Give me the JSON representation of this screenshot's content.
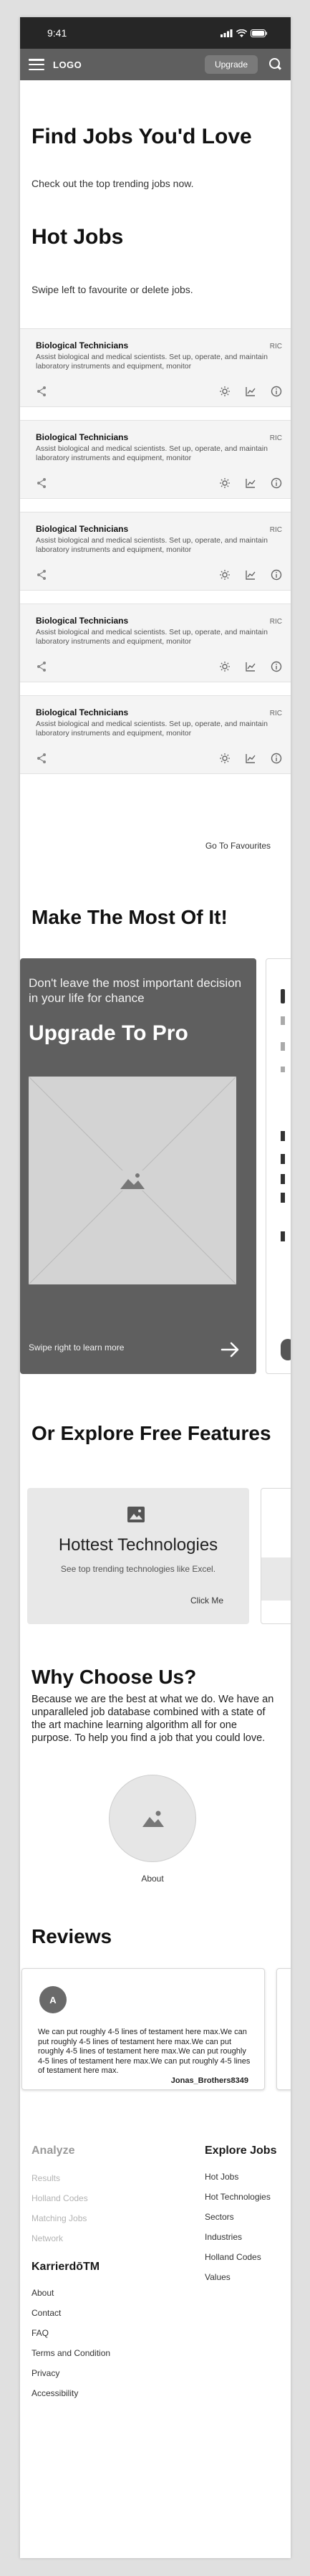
{
  "statusbar": {
    "time": "9:41"
  },
  "navbar": {
    "logo": "LOGO",
    "upgrade_label": "Upgrade"
  },
  "hero": {
    "title": "Find Jobs You'd Love",
    "subtitle": "Check out the top trending jobs now."
  },
  "hot_jobs": {
    "title": "Hot Jobs",
    "subtitle": "Swipe left to favourite or delete jobs.",
    "items": [
      {
        "title": "Biological Technicians",
        "code": "RIC",
        "desc": "Assist biological and medical scientists. Set up, operate, and maintain laboratory instruments and equipment, monitor"
      },
      {
        "title": "Biological Technicians",
        "code": "RIC",
        "desc": "Assist biological and medical scientists. Set up, operate, and maintain laboratory instruments and equipment, monitor"
      },
      {
        "title": "Biological Technicians",
        "code": "RIC",
        "desc": "Assist biological and medical scientists. Set up, operate, and maintain laboratory instruments and equipment, monitor"
      },
      {
        "title": "Biological Technicians",
        "code": "RIC",
        "desc": "Assist biological and medical scientists. Set up, operate, and maintain laboratory instruments and equipment, monitor"
      },
      {
        "title": "Biological Technicians",
        "code": "RIC",
        "desc": "Assist biological and medical scientists. Set up, operate, and maintain laboratory instruments and equipment, monitor"
      }
    ],
    "favourites_link": "Go To Favourites"
  },
  "most_of_it": {
    "title": "Make The Most Of It!",
    "lead": "Don't leave the most important decision in your life for chance",
    "big": "Upgrade To Pro",
    "hint": "Swipe right to learn more"
  },
  "features": {
    "title": "Or Explore Free Features",
    "card_title": "Hottest Technologies",
    "card_desc": "See top trending technologies like Excel.",
    "card_link": "Click Me"
  },
  "why": {
    "title": "Why Choose Us?",
    "body": "Because we are the best at what we do. We have an unparalleled job database combined with a state of the art machine learning algorithm all for one purpose. To help you find a job that you could love.",
    "about_label": "About"
  },
  "reviews": {
    "title": "Reviews",
    "avatar_letter": "A",
    "text": "We can put roughly 4-5 lines of testament here max.We can put roughly 4-5 lines of testament here max.We can put roughly 4-5 lines of testament here max.We can put roughly 4-5 lines of testament here max.We can put roughly 4-5 lines of testament here max.",
    "author": "Jonas_Brothers8349"
  },
  "footer": {
    "analyze": {
      "head": "Analyze",
      "items": [
        "Results",
        "Holland Codes",
        "Matching Jobs",
        "Network"
      ]
    },
    "explore": {
      "head": "Explore Jobs",
      "items": [
        "Hot Jobs",
        "Hot Technologies",
        "Sectors",
        "Industries",
        "Holland Codes",
        "Values"
      ]
    },
    "brand": {
      "head": "KarrierdōTM",
      "items": [
        "About",
        "Contact",
        "FAQ",
        "Terms and Condition",
        "Privacy",
        "Accessibility"
      ]
    }
  }
}
